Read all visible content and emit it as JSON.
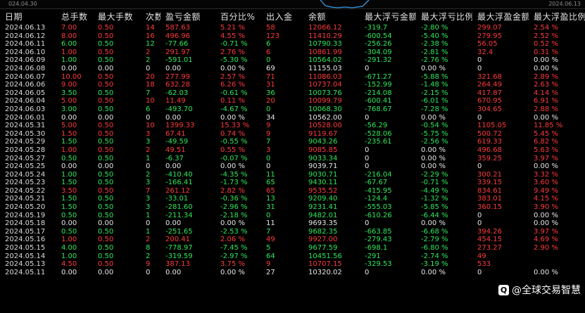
{
  "chart_strip": {
    "left_date": "024.04.30",
    "right_date": "2024.06.13",
    "line_color": "#3a9be8"
  },
  "colors": {
    "positive": "#ff3b3b",
    "negative": "#2ee85a",
    "neutral": "#e6e6e6"
  },
  "table": {
    "columns": [
      "日期",
      "总手数",
      "最大手数",
      "次数",
      "盈亏金额",
      "百分比%",
      "出入金",
      "余额",
      "最大浮亏金额",
      "最大浮亏比例",
      "最大浮盈金额",
      "最大浮盈比例"
    ],
    "rows": [
      [
        "2024.06.13",
        "7.00",
        "0.50",
        "14",
        "587.63",
        "5.21 %",
        "58",
        "12066.12",
        "-319.7",
        "-2.80 %",
        "299.07",
        "2.54 %"
      ],
      [
        "2024.06.12",
        "8.00",
        "0.50",
        "16",
        "496.96",
        "4.55 %",
        "123",
        "11410.29",
        "-600.54",
        "-5.40 %",
        "279.95",
        "2.52 %"
      ],
      [
        "2024.06.11",
        "6.00",
        "0.50",
        "12",
        "-77.66",
        "-0.71 %",
        "6",
        "10790.33",
        "-256.26",
        "-2.38 %",
        "56.05",
        "0.52 %"
      ],
      [
        "2024.06.10",
        "1.00",
        "0.50",
        "2",
        "291.97",
        "2.76 %",
        "6",
        "10861.99",
        "-304.09",
        "-2.81 %",
        "32.4",
        "0.31 %"
      ],
      [
        "2024.06.09",
        "1.00",
        "0.50",
        "2",
        "-591.01",
        "-5.30 %",
        "0",
        "10564.02",
        "-291.32",
        "-2.76 %",
        "0",
        "0.00 %"
      ],
      [
        "2024.06.08",
        "0.00",
        "0.00",
        "0",
        "0.00",
        "0.00 %",
        "69",
        "11155.03",
        "0",
        "0.00 %",
        "0",
        "0.00 %"
      ],
      [
        "2024.06.07",
        "10.00",
        "0.50",
        "20",
        "277.99",
        "2.57 %",
        "71",
        "11086.03",
        "-671.27",
        "-5.88 %",
        "321.68",
        "2.89 %"
      ],
      [
        "2024.06.06",
        "9.00",
        "0.50",
        "18",
        "632.28",
        "6.26 %",
        "31",
        "10737.04",
        "-152.99",
        "-1.48 %",
        "264.49",
        "2.63 %"
      ],
      [
        "2024.06.05",
        "3.50",
        "0.50",
        "7",
        "-62.03",
        "-0.61 %",
        "36",
        "10073.76",
        "-214.08",
        "-2.15 %",
        "417.87",
        "4.14 %"
      ],
      [
        "2024.06.04",
        "5.00",
        "0.50",
        "10",
        "11.49",
        "0.11 %",
        "20",
        "10099.79",
        "-600.41",
        "-6.01 %",
        "670.95",
        "6.91 %"
      ],
      [
        "2024.06.03",
        "3.00",
        "0.50",
        "6",
        "-493.70",
        "-4.67 %",
        "0",
        "10068.30",
        "-768.67",
        "-7.28 %",
        "304.65",
        "2.88 %"
      ],
      [
        "2024.06.01",
        "0.00",
        "0.00",
        "0",
        "0.00",
        "0.00 %",
        "34",
        "10562.00",
        "0",
        "0.00 %",
        "0",
        "0.00 %"
      ],
      [
        "2024.05.31",
        "5.00",
        "0.50",
        "10",
        "1399.33",
        "15.33 %",
        "9",
        "10528.00",
        "-56.29",
        "-0.54 %",
        "1105.05",
        "11.85 %"
      ],
      [
        "2024.05.30",
        "1.50",
        "0.50",
        "3",
        "67.41",
        "0.74 %",
        "9",
        "9119.67",
        "-528.06",
        "-5.75 %",
        "500.72",
        "5.45 %"
      ],
      [
        "2024.05.29",
        "1.50",
        "0.50",
        "3",
        "-49.59",
        "-0.55 %",
        "7",
        "9043.26",
        "-235.61",
        "-2.56 %",
        "619.33",
        "6.82 %"
      ],
      [
        "2024.05.28",
        "1.00",
        "0.50",
        "2",
        "49.51",
        "0.55 %",
        "3",
        "9085.85",
        "0",
        "0.00 %",
        "496.68",
        "5.63 %"
      ],
      [
        "2024.05.27",
        "0.50",
        "0.50",
        "1",
        "-6.37",
        "-0.07 %",
        "0",
        "9033.34",
        "0",
        "0.00 %",
        "359.25",
        "3.97 %"
      ],
      [
        "2024.05.25",
        "0.00",
        "0.00",
        "0",
        "0.00",
        "0.00 %",
        "0",
        "9039.71",
        "0",
        "0.00 %",
        "0",
        "0.00 %"
      ],
      [
        "2024.05.24",
        "1.00",
        "0.50",
        "2",
        "-410.40",
        "-4.35 %",
        "11",
        "9030.71",
        "-216.04",
        "-2.29 %",
        "300.21",
        "3.32 %"
      ],
      [
        "2024.05.23",
        "1.50",
        "0.50",
        "3",
        "-166.41",
        "-1.73 %",
        "65",
        "9430.11",
        "-67.67",
        "-0.71 %",
        "339.15",
        "3.60 %"
      ],
      [
        "2024.05.22",
        "3.50",
        "0.50",
        "7",
        "261.12",
        "2.82 %",
        "65",
        "9535.52",
        "-415.95",
        "-4.49 %",
        "834.61",
        "9.49 %"
      ],
      [
        "2024.05.21",
        "1.50",
        "0.50",
        "3",
        "-33.01",
        "-0.36 %",
        "13",
        "9209.40",
        "-124.4",
        "-1.32 %",
        "383.01",
        "4.15 %"
      ],
      [
        "2024.05.20",
        "1.50",
        "0.50",
        "3",
        "-281.60",
        "-2.96 %",
        "31",
        "9231.41",
        "-555.03",
        "-5.85 %",
        "360.15",
        "3.90 %"
      ],
      [
        "2024.05.19",
        "0.50",
        "0.50",
        "1",
        "-211.34",
        "-2.18 %",
        "0",
        "9482.01",
        "-610.26",
        "-6.44 %",
        "0",
        "0.00 %"
      ],
      [
        "2024.05.18",
        "0.00",
        "0.00",
        "0",
        "0.00",
        "0.00 %",
        "11",
        "9693.35",
        "0",
        "0.00 %",
        "0",
        "0.00 %"
      ],
      [
        "2024.05.17",
        "0.50",
        "0.50",
        "1",
        "-251.65",
        "-2.53 %",
        "7",
        "9682.35",
        "-663.85",
        "-6.68 %",
        "394.26",
        "3.97 %"
      ],
      [
        "2024.05.16",
        "1.00",
        "0.50",
        "2",
        "200.41",
        "2.06 %",
        "49",
        "9927.00",
        "-279.43",
        "-2.79 %",
        "454.15",
        "4.69 %"
      ],
      [
        "2024.05.15",
        "4.00",
        "0.50",
        "8",
        "-778.97",
        "-7.45 %",
        "5",
        "9677.59",
        "-698.1",
        "-6.80 %",
        "273.27",
        "2.90 %"
      ],
      [
        "2024.05.14",
        "1.00",
        "0.50",
        "2",
        "-319.59",
        "-2.97 %",
        "64",
        "10451.56",
        "-291",
        "-2.74 %",
        "49",
        ""
      ],
      [
        "2024.05.13",
        "4.50",
        "0.50",
        "9",
        "387.13",
        "3.75 %",
        "9",
        "10707.15",
        "-329.53",
        "-3.19 %",
        "533",
        ""
      ],
      [
        "2024.05.11",
        "0.00",
        "0.00",
        "0",
        "0.00",
        "0.00 %",
        "27",
        "10320.02",
        "0",
        "0.00 %",
        "0",
        "0.00 %"
      ]
    ]
  },
  "watermark": {
    "logo_glyph": "Q",
    "text": "@全球交易智慧"
  }
}
